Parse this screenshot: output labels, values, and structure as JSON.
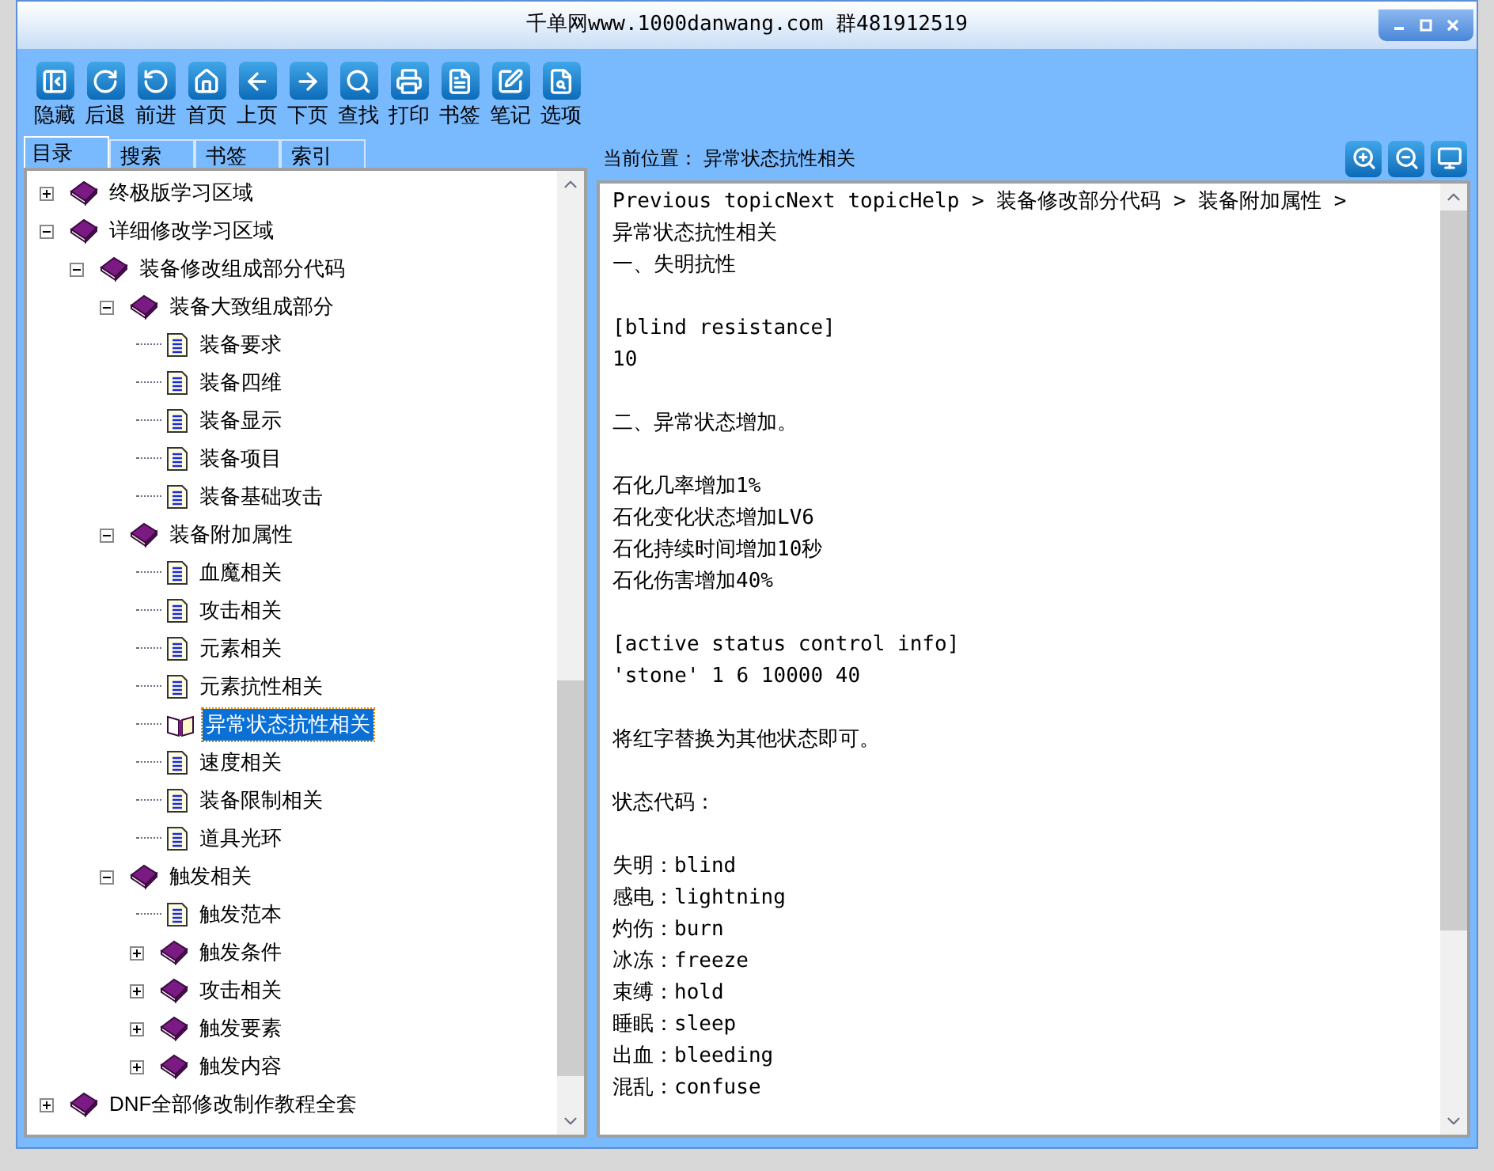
{
  "window": {
    "title": "千单网www.1000danwang.com 群481912519"
  },
  "toolbar": {
    "buttons": [
      {
        "label": "隐藏",
        "kind": "hide"
      },
      {
        "label": "后退",
        "kind": "back"
      },
      {
        "label": "前进",
        "kind": "forward"
      },
      {
        "label": "首页",
        "kind": "home"
      },
      {
        "label": "上页",
        "kind": "prev"
      },
      {
        "label": "下页",
        "kind": "next"
      },
      {
        "label": "查找",
        "kind": "search"
      },
      {
        "label": "打印",
        "kind": "print"
      },
      {
        "label": "书签",
        "kind": "bookmark"
      },
      {
        "label": "笔记",
        "kind": "note"
      },
      {
        "label": "选项",
        "kind": "options"
      }
    ]
  },
  "left_panel": {
    "tabs": [
      {
        "label": "目录",
        "selected": true
      },
      {
        "label": "搜索",
        "selected": false
      },
      {
        "label": "书签",
        "selected": false
      },
      {
        "label": "索引",
        "selected": false
      }
    ],
    "tree": [
      {
        "label": "终极版学习区域",
        "kind": "book",
        "expanded": false,
        "selected": false
      },
      {
        "label": "详细修改学习区域",
        "kind": "book",
        "expanded": true,
        "selected": false,
        "children": [
          {
            "label": "装备修改组成部分代码",
            "kind": "book",
            "expanded": true,
            "selected": false,
            "children": [
              {
                "label": "装备大致组成部分",
                "kind": "book",
                "expanded": true,
                "selected": false,
                "children": [
                  {
                    "label": "装备要求",
                    "kind": "page",
                    "selected": false
                  },
                  {
                    "label": "装备四维",
                    "kind": "page",
                    "selected": false
                  },
                  {
                    "label": "装备显示",
                    "kind": "page",
                    "selected": false
                  },
                  {
                    "label": "装备项目",
                    "kind": "page",
                    "selected": false
                  },
                  {
                    "label": "装备基础攻击",
                    "kind": "page",
                    "selected": false
                  }
                ]
              },
              {
                "label": "装备附加属性",
                "kind": "book",
                "expanded": true,
                "selected": false,
                "children": [
                  {
                    "label": "血魔相关",
                    "kind": "page",
                    "selected": false
                  },
                  {
                    "label": "攻击相关",
                    "kind": "page",
                    "selected": false
                  },
                  {
                    "label": "元素相关",
                    "kind": "page",
                    "selected": false
                  },
                  {
                    "label": "元素抗性相关",
                    "kind": "page",
                    "selected": false
                  },
                  {
                    "label": "异常状态抗性相关",
                    "kind": "page",
                    "selected": true
                  },
                  {
                    "label": "速度相关",
                    "kind": "page",
                    "selected": false
                  },
                  {
                    "label": "装备限制相关",
                    "kind": "page",
                    "selected": false
                  },
                  {
                    "label": "道具光环",
                    "kind": "page",
                    "selected": false
                  }
                ]
              },
              {
                "label": "触发相关",
                "kind": "book",
                "expanded": true,
                "selected": false,
                "children": [
                  {
                    "label": "触发范本",
                    "kind": "page",
                    "selected": false
                  },
                  {
                    "label": "触发条件",
                    "kind": "book",
                    "expanded": false,
                    "selected": false
                  },
                  {
                    "label": "攻击相关",
                    "kind": "book",
                    "expanded": false,
                    "selected": false
                  },
                  {
                    "label": "触发要素",
                    "kind": "book",
                    "expanded": false,
                    "selected": false
                  },
                  {
                    "label": "触发内容",
                    "kind": "book",
                    "expanded": false,
                    "selected": false
                  }
                ]
              }
            ]
          }
        ]
      },
      {
        "label": "DNF全部修改制作教程全套",
        "kind": "book",
        "expanded": false,
        "selected": false
      }
    ]
  },
  "right_panel": {
    "location": "当前位置： 异常状态抗性相关",
    "content": [
      [
        "Previous topicNext topicHelp > 装备修改部分代码 > 装备附加属性 >",
        "异常状态抗性相关",
        "一、失明抗性"
      ],
      [
        "[blind resistance]",
        "10"
      ],
      [
        "二、异常状态增加。"
      ],
      [
        "石化几率增加1%",
        "石化变化状态增加LV6",
        "石化持续时间增加10秒",
        "石化伤害增加40%"
      ],
      [
        "[active status control info]",
        "'stone' 1 6 10000 40"
      ],
      [
        "将红字替换为其他状态即可。"
      ],
      [
        "状态代码："
      ],
      [
        "失明：blind",
        "感电：lightning",
        "灼伤：burn",
        "冰冻：freeze",
        "束缚：hold",
        "睡眠：sleep",
        "出血：bleeding",
        "混乱：confuse"
      ]
    ]
  }
}
